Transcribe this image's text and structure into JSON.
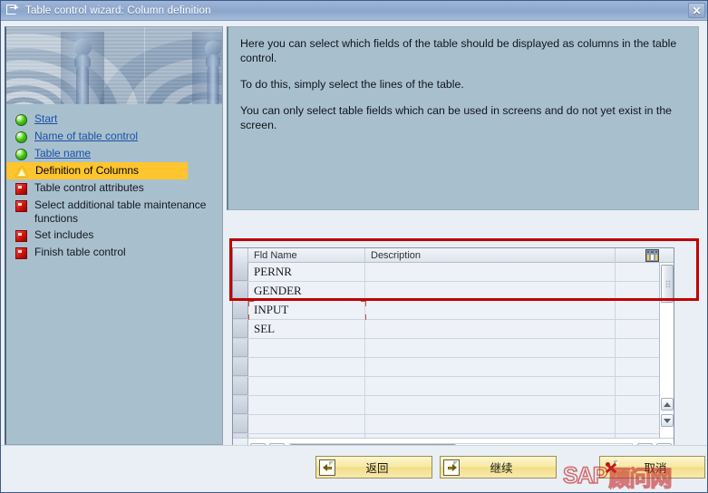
{
  "window": {
    "title": "Table control wizard: Column definition",
    "title_icon": "wizard-icon",
    "close_label": "✕"
  },
  "sidebar": {
    "hero_icon": "chess-pawns-ripple-image",
    "steps": [
      {
        "label": "Start",
        "state": "done",
        "icon": "green-circle-icon"
      },
      {
        "label": "Name of table control",
        "state": "done",
        "icon": "green-circle-icon"
      },
      {
        "label": "Table name",
        "state": "done",
        "icon": "green-circle-icon"
      },
      {
        "label": "Definition of Columns",
        "state": "current",
        "icon": "yellow-warning-triangle-icon"
      },
      {
        "label": "Table control attributes",
        "state": "pending",
        "icon": "red-square-icon"
      },
      {
        "label": "Select additional table maintenance functions",
        "state": "pending",
        "icon": "red-square-icon"
      },
      {
        "label": "Set includes",
        "state": "pending",
        "icon": "red-square-icon"
      },
      {
        "label": "Finish table control",
        "state": "pending",
        "icon": "red-square-icon"
      }
    ]
  },
  "info": {
    "paragraphs": [
      "Here you can select which fields of the table should be displayed as columns in the table control.",
      "To do this, simply select the lines of the table.",
      "You can only select table fields which can be used in screens and do not yet exist in the screen."
    ]
  },
  "table": {
    "grid_icon": "table-grid-icon",
    "columns": [
      "Fld Name",
      "Description"
    ],
    "rows": [
      {
        "fld": "PERNR",
        "desc": "",
        "selected": true,
        "empty": false
      },
      {
        "fld": "GENDER",
        "desc": "",
        "selected": true,
        "empty": false
      },
      {
        "fld": "INPUT",
        "desc": "",
        "selected": true,
        "empty": false,
        "cursor": true
      },
      {
        "fld": "SEL",
        "desc": "",
        "selected": false,
        "empty": false
      },
      {
        "fld": "",
        "desc": "",
        "selected": false,
        "empty": true
      },
      {
        "fld": "",
        "desc": "",
        "selected": false,
        "empty": true
      },
      {
        "fld": "",
        "desc": "",
        "selected": false,
        "empty": true
      },
      {
        "fld": "",
        "desc": "",
        "selected": false,
        "empty": true
      },
      {
        "fld": "",
        "desc": "",
        "selected": false,
        "empty": true
      },
      {
        "fld": "",
        "desc": "",
        "selected": false,
        "empty": true
      }
    ],
    "scroll": {
      "vertical_thumb_position": "top",
      "horizontal_thumb_position": "left"
    }
  },
  "footer": {
    "buttons": [
      {
        "name": "back",
        "label": "返回",
        "icon": "back-arrow-doc-icon"
      },
      {
        "name": "continue",
        "label": "继续",
        "icon": "forward-arrow-doc-icon"
      },
      {
        "name": "cancel",
        "label": "取消",
        "icon": "cancel-x-icon"
      }
    ]
  },
  "watermark": {
    "prefix": "SAP",
    "suffix": "顾问网"
  },
  "colors": {
    "titlebar": "#8fa8cd",
    "panel_blue": "#a8c0ce",
    "highlight_yellow": "#ffc52e",
    "row_selected": "#ffdd80",
    "annotation_red": "#c00000",
    "button_yellow": "#f7e8a3",
    "link_blue": "#1b4fa8"
  }
}
